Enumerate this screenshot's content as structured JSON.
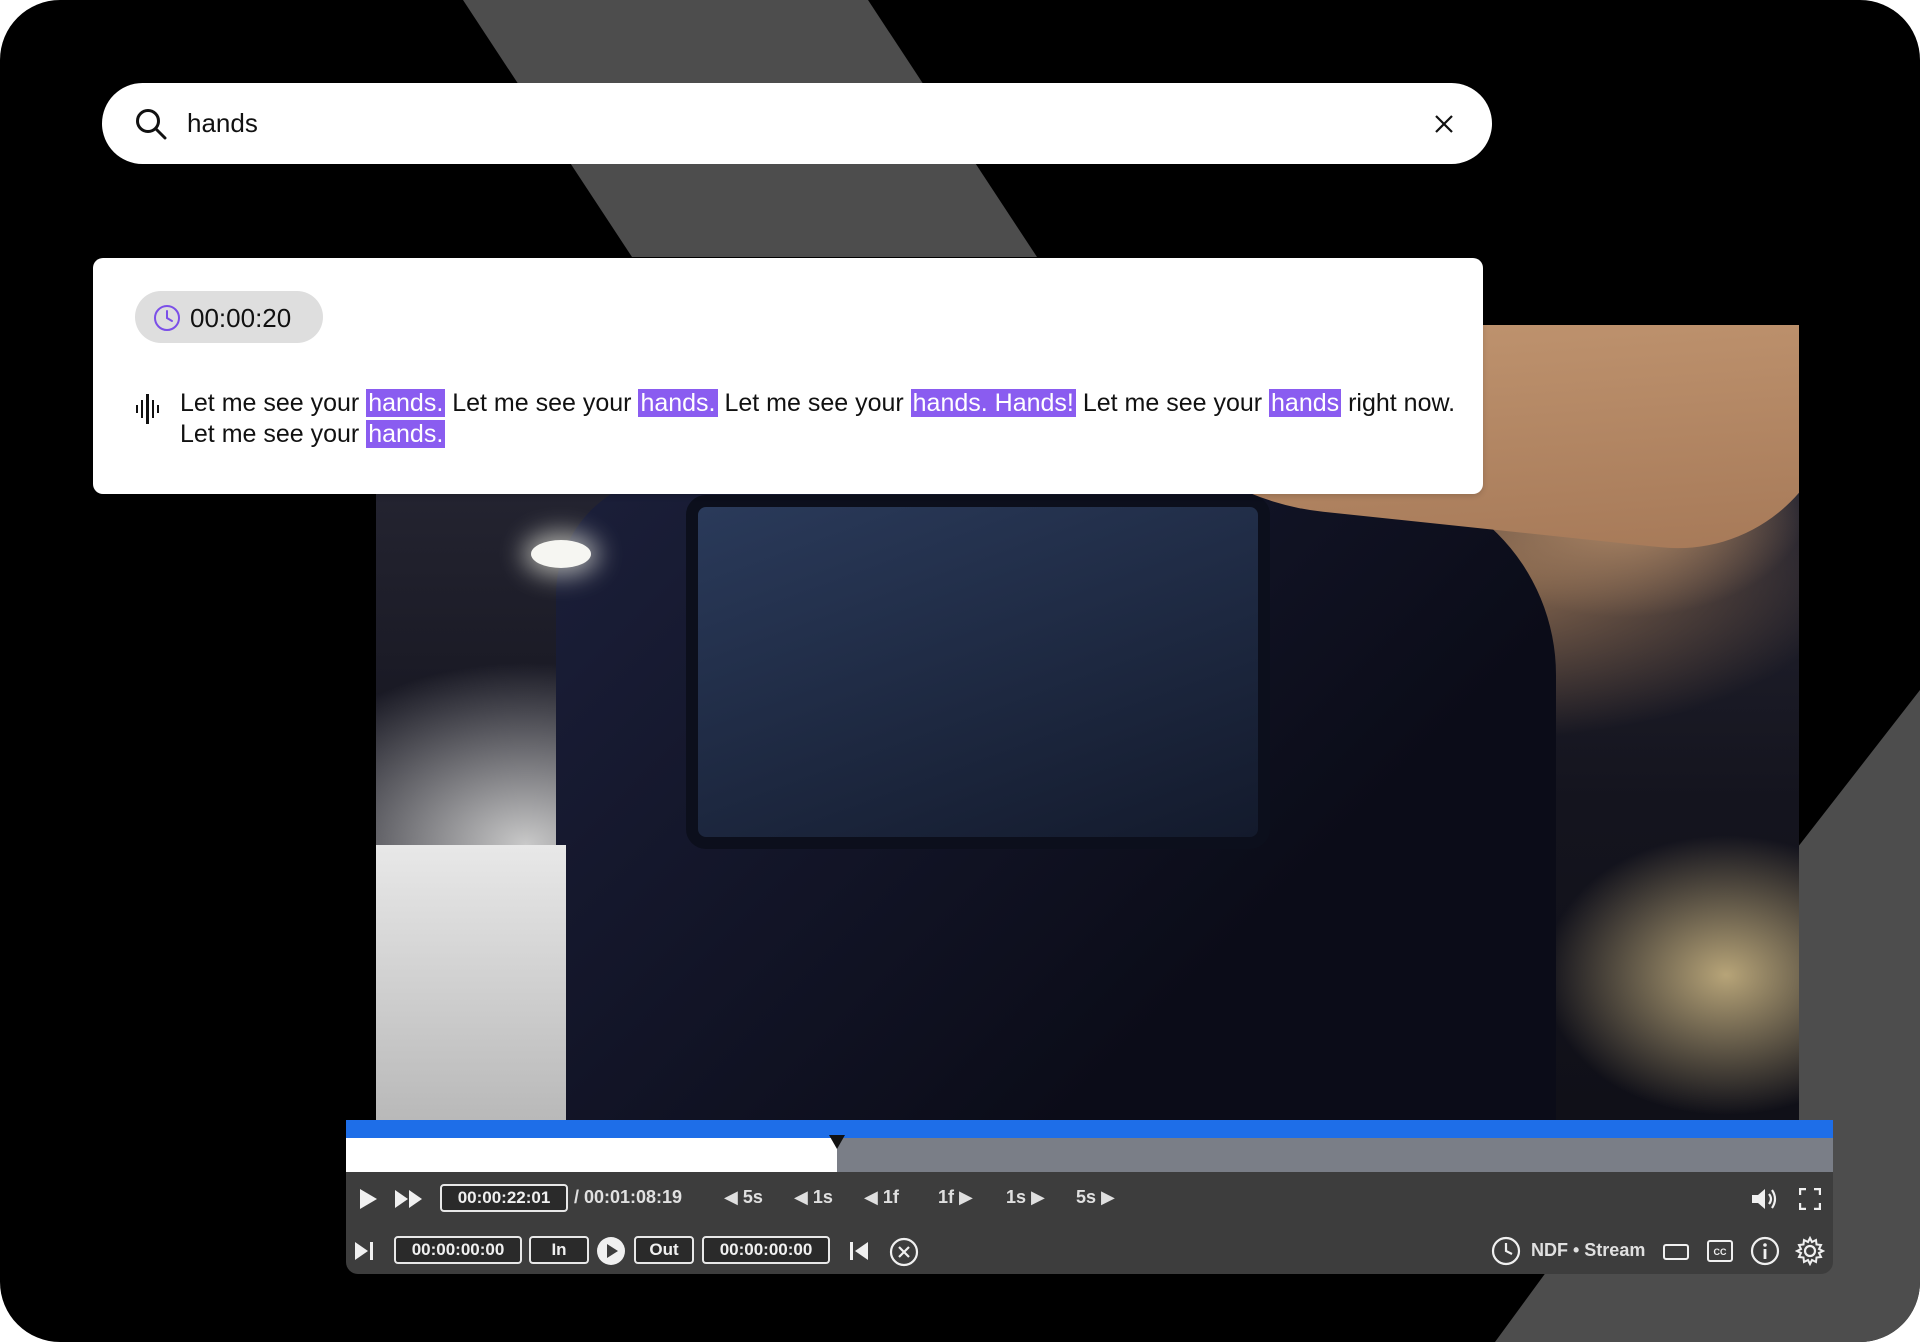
{
  "search": {
    "query": "hands",
    "icon": "search-icon",
    "clear_icon": "close-icon"
  },
  "result": {
    "timestamp": "00:00:20",
    "transcript_segments": [
      {
        "text": "Let me see your ",
        "highlight": false
      },
      {
        "text": "hands.",
        "highlight": true
      },
      {
        "text": " Let me see your ",
        "highlight": false
      },
      {
        "text": "hands.",
        "highlight": true
      },
      {
        "text": " Let me see your ",
        "highlight": false
      },
      {
        "text": "hands. Hands!",
        "highlight": true
      },
      {
        "text": " Let me see your ",
        "highlight": false
      },
      {
        "text": "hands",
        "highlight": true
      },
      {
        "text": " right now. Let me see your ",
        "highlight": false
      },
      {
        "text": "hands.",
        "highlight": true
      }
    ]
  },
  "player": {
    "progress_fraction": 0.33,
    "current_time": "00:00:22:01",
    "duration": "/ 00:01:08:19",
    "steps": [
      "5s",
      "1s",
      "1f",
      "1f",
      "1s",
      "5s"
    ],
    "in_time": "00:00:00:00",
    "in_label": "In",
    "out_label": "Out",
    "out_time": "00:00:00:00",
    "timecode_mode": "NDF • Stream"
  },
  "colors": {
    "highlight": "#8a5cf0",
    "progress_blue": "#1e6ee8",
    "controls_bg": "#3d3d3d"
  }
}
